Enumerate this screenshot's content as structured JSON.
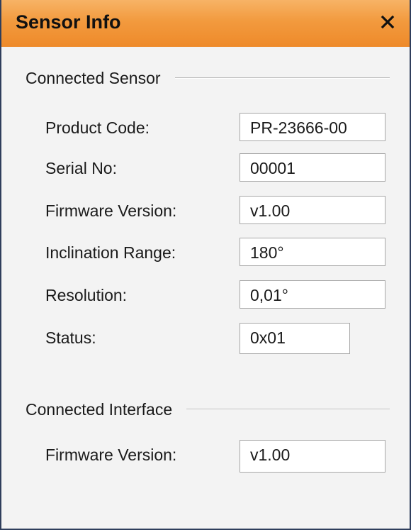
{
  "window": {
    "title": "Sensor Info",
    "close_icon": "close-icon",
    "accent_color": "#f29a3e"
  },
  "connected_sensor": {
    "heading": "Connected Sensor",
    "fields": [
      {
        "label": "Product Code:",
        "value": "PR-23666-00"
      },
      {
        "label": "Serial No:",
        "value": "00001"
      },
      {
        "label": "Firmware Version:",
        "value": "v1.00"
      },
      {
        "label": "Inclination Range:",
        "value": "180°"
      },
      {
        "label": "Resolution:",
        "value": "0,01°"
      },
      {
        "label": "Status:",
        "value": "0x01"
      }
    ]
  },
  "connected_interface": {
    "heading": "Connected Interface",
    "fields": [
      {
        "label": "Firmware Version:",
        "value": "v1.00"
      }
    ]
  }
}
